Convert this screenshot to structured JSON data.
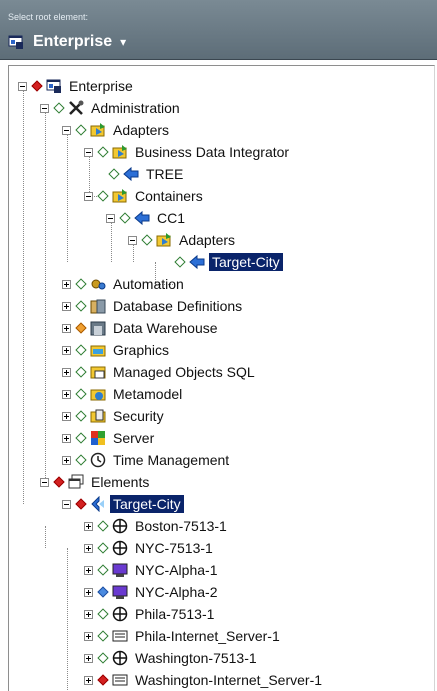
{
  "header": {
    "label": "Select root element:",
    "root": "Enterprise",
    "chevron": "▾"
  },
  "tree": [
    {
      "label": "Enterprise",
      "icon": "enterprise-icon"
    },
    {
      "label": "Administration",
      "icon": "tools-icon"
    },
    {
      "label": "Adapters",
      "icon": "adapter-icon"
    },
    {
      "label": "Business Data Integrator",
      "icon": "adapter-icon"
    },
    {
      "label": "TREE",
      "icon": "blue-arrow-icon"
    },
    {
      "label": "Containers",
      "icon": "adapter-icon"
    },
    {
      "label": "CC1",
      "icon": "blue-arrow-icon"
    },
    {
      "label": "Adapters",
      "icon": "adapter-icon"
    },
    {
      "label": "Target-City",
      "icon": "blue-arrow-icon",
      "selected": true
    },
    {
      "label": "Automation",
      "icon": "automation-icon"
    },
    {
      "label": "Database Definitions",
      "icon": "database-icon"
    },
    {
      "label": "Data Warehouse",
      "icon": "warehouse-icon"
    },
    {
      "label": "Graphics",
      "icon": "graphics-folder-icon"
    },
    {
      "label": "Managed Objects SQL",
      "icon": "sql-icon"
    },
    {
      "label": "Metamodel",
      "icon": "metamodel-icon"
    },
    {
      "label": "Security",
      "icon": "security-icon"
    },
    {
      "label": "Server",
      "icon": "server-icon"
    },
    {
      "label": "Time Management",
      "icon": "clock-icon"
    },
    {
      "label": "Elements",
      "icon": "elements-icon"
    },
    {
      "label": "Target-City",
      "icon": "target-icon",
      "selected": true
    },
    {
      "label": "Boston-7513-1",
      "icon": "router-icon"
    },
    {
      "label": "NYC-7513-1",
      "icon": "router-icon"
    },
    {
      "label": "NYC-Alpha-1",
      "icon": "workstation-icon"
    },
    {
      "label": "NYC-Alpha-2",
      "icon": "workstation-icon"
    },
    {
      "label": "Phila-7513-1",
      "icon": "router-icon"
    },
    {
      "label": "Phila-Internet_Server-1",
      "icon": "internet-server-icon"
    },
    {
      "label": "Washington-7513-1",
      "icon": "router-icon"
    },
    {
      "label": "Washington-Internet_Server-1",
      "icon": "internet-server-icon"
    }
  ]
}
